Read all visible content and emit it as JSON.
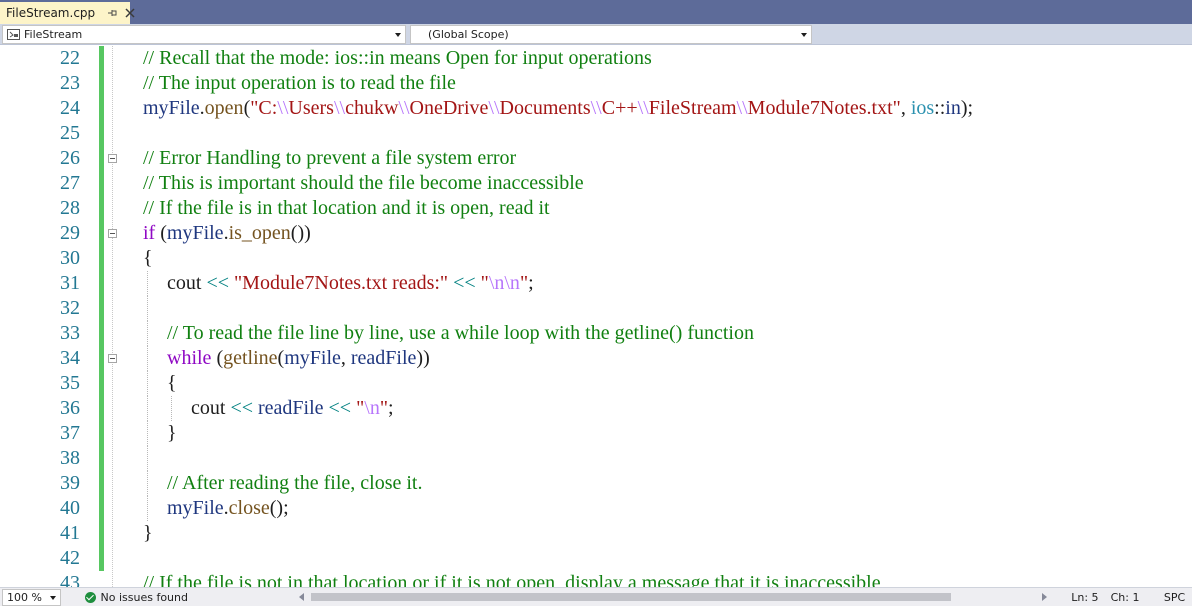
{
  "tab": {
    "title": "FileStream.cpp"
  },
  "navbar": {
    "project": "FileStream",
    "scope": "(Global Scope)"
  },
  "editor": {
    "lines": [
      {
        "n": "22",
        "indent": 0,
        "fold": false,
        "tokens": [
          {
            "t": "// Recall that the mode: ios::in means Open for input operations",
            "c": "comment"
          }
        ]
      },
      {
        "n": "23",
        "indent": 0,
        "fold": false,
        "tokens": [
          {
            "t": "// The input operation is to read the file",
            "c": "comment"
          }
        ]
      },
      {
        "n": "24",
        "indent": 0,
        "fold": false,
        "tokens": [
          {
            "t": "myFile",
            "c": "ident"
          },
          {
            "t": ".",
            "c": "punct"
          },
          {
            "t": "open",
            "c": "func"
          },
          {
            "t": "(",
            "c": "punct"
          },
          {
            "t": "\"C:",
            "c": "str"
          },
          {
            "t": "\\\\",
            "c": "esc"
          },
          {
            "t": "Users",
            "c": "str"
          },
          {
            "t": "\\\\",
            "c": "esc"
          },
          {
            "t": "chukw",
            "c": "str"
          },
          {
            "t": "\\\\",
            "c": "esc"
          },
          {
            "t": "OneDrive",
            "c": "str"
          },
          {
            "t": "\\\\",
            "c": "esc"
          },
          {
            "t": "Documents",
            "c": "str"
          },
          {
            "t": "\\\\",
            "c": "esc"
          },
          {
            "t": "C++",
            "c": "str"
          },
          {
            "t": "\\\\",
            "c": "esc"
          },
          {
            "t": "FileStream",
            "c": "str"
          },
          {
            "t": "\\\\",
            "c": "esc"
          },
          {
            "t": "Module7Notes.txt\"",
            "c": "str"
          },
          {
            "t": ", ",
            "c": "punct"
          },
          {
            "t": "ios",
            "c": "enum"
          },
          {
            "t": "::",
            "c": "punct"
          },
          {
            "t": "in",
            "c": "ident"
          },
          {
            "t": ");",
            "c": "punct"
          }
        ]
      },
      {
        "n": "25",
        "indent": 0,
        "fold": false,
        "tokens": []
      },
      {
        "n": "26",
        "indent": 0,
        "fold": true,
        "tokens": [
          {
            "t": "// Error Handling to prevent a file system error",
            "c": "comment"
          }
        ]
      },
      {
        "n": "27",
        "indent": 0,
        "fold": false,
        "tokens": [
          {
            "t": "// This is important should the file become inaccessible",
            "c": "comment"
          }
        ]
      },
      {
        "n": "28",
        "indent": 0,
        "fold": false,
        "tokens": [
          {
            "t": "// If the file is in that location and it is open, read it",
            "c": "comment"
          }
        ]
      },
      {
        "n": "29",
        "indent": 0,
        "fold": true,
        "tokens": [
          {
            "t": "if",
            "c": "kw"
          },
          {
            "t": " (",
            "c": "punct"
          },
          {
            "t": "myFile",
            "c": "ident"
          },
          {
            "t": ".",
            "c": "punct"
          },
          {
            "t": "is_open",
            "c": "func"
          },
          {
            "t": "())",
            "c": "punct"
          }
        ]
      },
      {
        "n": "30",
        "indent": 0,
        "fold": false,
        "tokens": [
          {
            "t": "{",
            "c": "punct"
          }
        ]
      },
      {
        "n": "31",
        "indent": 1,
        "fold": false,
        "tokens": [
          {
            "t": "cout",
            "c": "punct"
          },
          {
            "t": " << ",
            "c": "op"
          },
          {
            "t": "\"Module7Notes.txt reads:\"",
            "c": "str"
          },
          {
            "t": " << ",
            "c": "op"
          },
          {
            "t": "\"",
            "c": "str"
          },
          {
            "t": "\\n\\n",
            "c": "esc"
          },
          {
            "t": "\"",
            "c": "str"
          },
          {
            "t": ";",
            "c": "punct"
          }
        ]
      },
      {
        "n": "32",
        "indent": 1,
        "fold": false,
        "tokens": []
      },
      {
        "n": "33",
        "indent": 1,
        "fold": false,
        "tokens": [
          {
            "t": "// To read the file line by line, use a while loop with the getline() function",
            "c": "comment"
          }
        ]
      },
      {
        "n": "34",
        "indent": 1,
        "fold": true,
        "tokens": [
          {
            "t": "while",
            "c": "kw"
          },
          {
            "t": " (",
            "c": "punct"
          },
          {
            "t": "getline",
            "c": "func"
          },
          {
            "t": "(",
            "c": "punct"
          },
          {
            "t": "myFile",
            "c": "ident"
          },
          {
            "t": ", ",
            "c": "punct"
          },
          {
            "t": "readFile",
            "c": "ident"
          },
          {
            "t": "))",
            "c": "punct"
          }
        ]
      },
      {
        "n": "35",
        "indent": 1,
        "fold": false,
        "tokens": [
          {
            "t": "{",
            "c": "punct"
          }
        ]
      },
      {
        "n": "36",
        "indent": 2,
        "fold": false,
        "tokens": [
          {
            "t": "cout",
            "c": "punct"
          },
          {
            "t": " << ",
            "c": "op"
          },
          {
            "t": "readFile",
            "c": "ident"
          },
          {
            "t": " << ",
            "c": "op"
          },
          {
            "t": "\"",
            "c": "str"
          },
          {
            "t": "\\n",
            "c": "esc"
          },
          {
            "t": "\"",
            "c": "str"
          },
          {
            "t": ";",
            "c": "punct"
          }
        ]
      },
      {
        "n": "37",
        "indent": 1,
        "fold": false,
        "tokens": [
          {
            "t": "}",
            "c": "punct"
          }
        ]
      },
      {
        "n": "38",
        "indent": 1,
        "fold": false,
        "tokens": []
      },
      {
        "n": "39",
        "indent": 1,
        "fold": false,
        "tokens": [
          {
            "t": "// After reading the file, close it.",
            "c": "comment"
          }
        ]
      },
      {
        "n": "40",
        "indent": 1,
        "fold": false,
        "tokens": [
          {
            "t": "myFile",
            "c": "ident"
          },
          {
            "t": ".",
            "c": "punct"
          },
          {
            "t": "close",
            "c": "func"
          },
          {
            "t": "();",
            "c": "punct"
          }
        ]
      },
      {
        "n": "41",
        "indent": 0,
        "fold": false,
        "tokens": [
          {
            "t": "}",
            "c": "punct"
          }
        ]
      },
      {
        "n": "42",
        "indent": 0,
        "fold": false,
        "tokens": []
      },
      {
        "n": "43",
        "indent": 0,
        "fold": false,
        "tokens": [
          {
            "t": "// If the file is not in that location or if it is not open, display a message that it is inaccessible",
            "c": "comment"
          }
        ]
      }
    ]
  },
  "status": {
    "zoom": "100 %",
    "issues": "No issues found",
    "line": "Ln: 5",
    "col": "Ch: 1",
    "mode": "SPC"
  },
  "colors": {
    "tab_bg": "#fdf4c9",
    "chrome": "#5d6b99",
    "change_bar": "#57c761",
    "line_number": "#237893",
    "comment": "#118011"
  }
}
